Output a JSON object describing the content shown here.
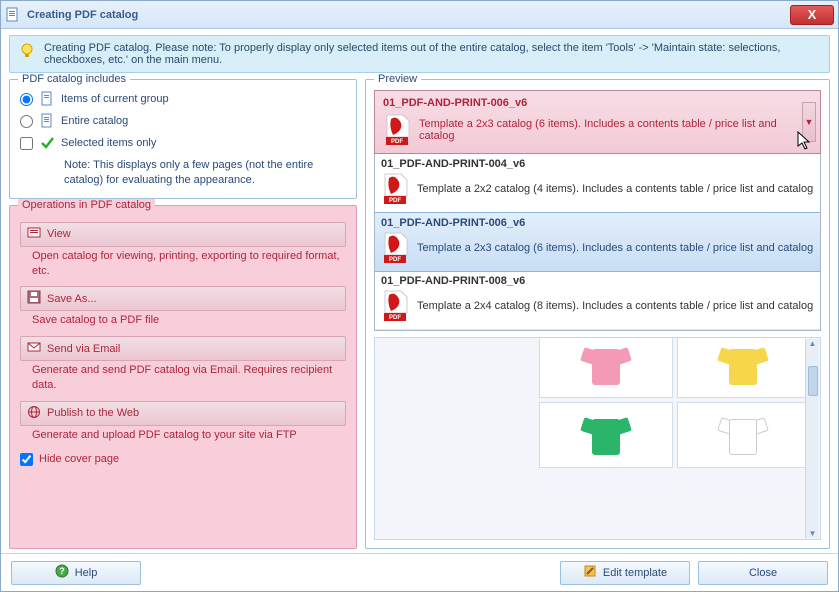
{
  "window": {
    "title": "Creating PDF catalog"
  },
  "info": {
    "text": "Creating PDF catalog. Please note: To properly display only selected items out of the entire catalog, select the item  'Tools' -> 'Maintain state: selections, checkboxes, etc.' on the main menu."
  },
  "includes": {
    "group_label": "PDF catalog includes",
    "options": [
      {
        "label": "Items of current group",
        "checked": true
      },
      {
        "label": "Entire catalog",
        "checked": false
      }
    ],
    "selected_only": {
      "label": "Selected items only",
      "checked": false
    },
    "note": "Note: This displays only a few pages (not the entire catalog) for evaluating the appearance."
  },
  "operations": {
    "group_label": "Operations in PDF catalog",
    "items": [
      {
        "label": "View",
        "desc": "Open catalog for viewing, printing, exporting to required format, etc."
      },
      {
        "label": "Save As...",
        "desc": "Save catalog to a PDF file"
      },
      {
        "label": "Send via Email",
        "desc": "Generate and send PDF catalog via Email. Requires recipient data."
      },
      {
        "label": "Publish to the Web",
        "desc": "Generate and upload PDF catalog to your site via FTP"
      }
    ],
    "hide_cover": {
      "label": "Hide cover page",
      "checked": true
    }
  },
  "preview": {
    "group_label": "Preview",
    "selected": {
      "title": "01_PDF-AND-PRINT-006_v6",
      "desc": "Template a 2x3 catalog (6 items). Includes a contents table / price list and catalog"
    },
    "dropdown": [
      {
        "title": "01_PDF-AND-PRINT-004_v6",
        "desc": "Template a 2x2 catalog (4 items). Includes a contents table / price list and catalog",
        "selected": false
      },
      {
        "title": "01_PDF-AND-PRINT-006_v6",
        "desc": "Template a 2x3 catalog (6 items). Includes a contents table / price list and catalog",
        "selected": true
      },
      {
        "title": "01_PDF-AND-PRINT-008_v6",
        "desc": "Template a 2x4 catalog (8 items). Includes a contents table / price list and catalog",
        "selected": false
      }
    ],
    "products": [
      {
        "color": "#f59ab5"
      },
      {
        "color": "#f6d64a"
      },
      {
        "color": "#2bb56a"
      },
      {
        "color": "#ffffff"
      }
    ]
  },
  "footer": {
    "help": "Help",
    "edit_template": "Edit template",
    "close": "Close"
  }
}
